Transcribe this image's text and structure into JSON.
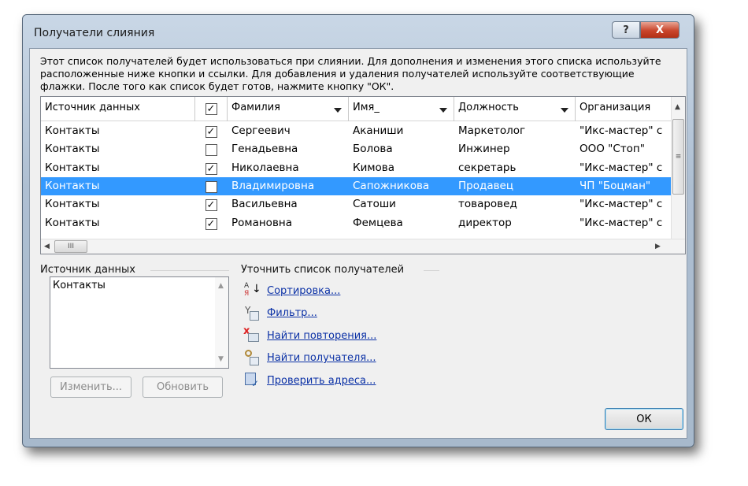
{
  "window": {
    "title": "Получатели слияния",
    "help": "?",
    "close": "X"
  },
  "description": "Этот список получателей будет использоваться при слиянии. Для дополнения и изменения этого списка используйте расположенные ниже кнопки и ссылки. Для добавления и удаления получателей используйте соответствующие флажки. После того как список будет готов, нажмите кнопку \"ОК\".",
  "table": {
    "columns": [
      "Источник данных",
      "",
      "Фамилия",
      "Имя_",
      "Должность",
      "Организация"
    ],
    "header_checked": true,
    "rows": [
      {
        "source": "Контакты",
        "checked": true,
        "last": "Сергеевич",
        "first": "Аканиши",
        "position": "Маркетолог",
        "org": "\"Икс-мастер\" с"
      },
      {
        "source": "Контакты",
        "checked": false,
        "last": "Генадьевна",
        "first": "Болова",
        "position": "Инжинер",
        "org": "ООО \"Стоп\""
      },
      {
        "source": "Контакты",
        "checked": true,
        "last": "Николаевна",
        "first": "Кимова",
        "position": "секретарь",
        "org": "\"Икс-мастер\" с"
      },
      {
        "source": "Контакты",
        "checked": false,
        "last": "Владимировна",
        "first": "Сапожникова",
        "position": "Продавец",
        "org": "ЧП \"Боцман\"",
        "selected": true
      },
      {
        "source": "Контакты",
        "checked": true,
        "last": "Васильевна",
        "first": "Сатоши",
        "position": "товаровед",
        "org": "\"Икс-мастер\" с"
      },
      {
        "source": "Контакты",
        "checked": true,
        "last": "Романовна",
        "first": "Фемцева",
        "position": "директор",
        "org": "\"Икс-мастер\" с"
      }
    ]
  },
  "data_source": {
    "label": "Источник данных",
    "items": [
      "Контакты"
    ],
    "edit": "Изменить...",
    "refresh": "Обновить"
  },
  "refine": {
    "label": "Уточнить список получателей",
    "links": [
      {
        "icon": "sort-icon",
        "text": "Сортировка..."
      },
      {
        "icon": "filter-icon",
        "text": "Фильтр..."
      },
      {
        "icon": "find-duplicates-icon",
        "text": "Найти повторения..."
      },
      {
        "icon": "find-recipient-icon",
        "text": "Найти получателя..."
      },
      {
        "icon": "validate-addresses-icon",
        "text": "Проверить адреса..."
      }
    ]
  },
  "ok": "ОК"
}
